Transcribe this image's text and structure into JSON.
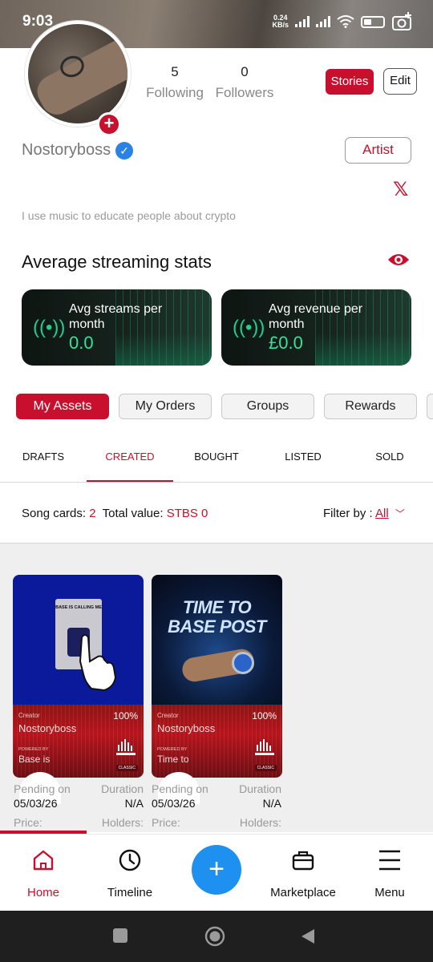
{
  "status_bar": {
    "time": "9:03",
    "net_speed_value": "0.24",
    "net_speed_unit": "KB/s"
  },
  "profile": {
    "following_count": "5",
    "following_label": "Following",
    "followers_count": "0",
    "followers_label": "Followers",
    "stories_label": "Stories",
    "edit_label": "Edit",
    "username": "Nostoryboss",
    "role_label": "Artist",
    "bio": "I use music to educate people about crypto"
  },
  "streaming_stats": {
    "title": "Average streaming stats",
    "cards": [
      {
        "label": "Avg streams per month",
        "value": "0.0"
      },
      {
        "label": "Avg revenue per month",
        "value": "£0.0"
      }
    ]
  },
  "pill_tabs": [
    "My Assets",
    "My Orders",
    "Groups",
    "Rewards"
  ],
  "sub_tabs": [
    "DRAFTS",
    "CREATED",
    "BOUGHT",
    "LISTED",
    "SOLD"
  ],
  "summary": {
    "song_cards_label": "Song cards:",
    "song_cards_value": "2",
    "total_value_label": "Total value:",
    "total_value_value": "STBS 0",
    "filter_label": "Filter by :",
    "filter_value": "All"
  },
  "song_cards": [
    {
      "art_text": "BASE IS CALLING ME",
      "creator_label": "Creator",
      "percent": "100%",
      "creator": "Nostoryboss",
      "powered_label": "POWERED BY",
      "title": "Base is",
      "tier": "CLASSIC",
      "status_label": "Pending on",
      "date": "05/03/26",
      "duration_label": "Duration",
      "duration": "N/A",
      "price_label": "Price:",
      "holders_label": "Holders:"
    },
    {
      "art_text_line1": "TIME TO",
      "art_text_line2": "BASE POST",
      "creator_label": "Creator",
      "percent": "100%",
      "creator": "Nostoryboss",
      "powered_label": "POWERED BY",
      "title": "Time to",
      "tier": "CLASSIC",
      "status_label": "Pending on",
      "date": "05/03/26",
      "duration_label": "Duration",
      "duration": "N/A",
      "price_label": "Price:",
      "holders_label": "Holders:"
    }
  ],
  "bottom_nav": {
    "home": "Home",
    "timeline": "Timeline",
    "marketplace": "Marketplace",
    "menu": "Menu"
  },
  "colors": {
    "accent": "#c8102e",
    "fab": "#1e90f0",
    "stat_green": "#34e39c"
  }
}
